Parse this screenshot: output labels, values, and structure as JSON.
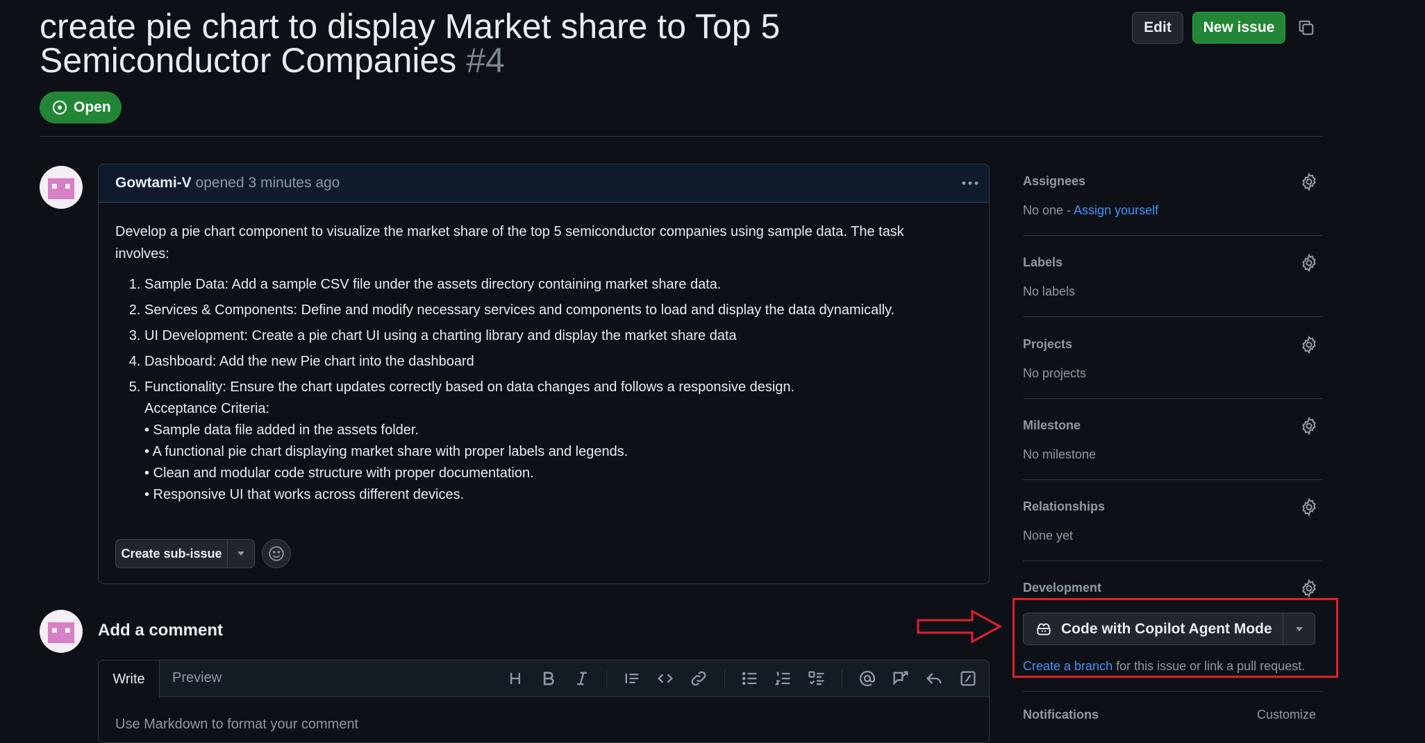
{
  "issue": {
    "title": "create pie chart to display Market share to Top 5 Semiconductor Companies",
    "number": "#4",
    "state": "Open"
  },
  "header": {
    "edit_label": "Edit",
    "new_issue_label": "New issue"
  },
  "comment": {
    "author": "Gowtami-V",
    "meta": "opened 3 minutes ago",
    "intro": "Develop a pie chart component to visualize the market share of the top 5 semiconductor companies using sample data. The task involves:",
    "tasks": [
      "Sample Data: Add a sample CSV file under the assets directory containing market share data.",
      "Services & Components: Define and modify necessary services and components to load and display the data dynamically.",
      "UI Development: Create a pie chart UI using a charting library and display the market share data",
      "Dashboard: Add the new Pie chart into the dashboard",
      "Functionality: Ensure the chart updates correctly based on data changes and follows a responsive design."
    ],
    "criteria_heading": "Acceptance Criteria:",
    "criteria": [
      "• Sample data file added in the assets folder.",
      "• A functional pie chart displaying market share with proper labels and legends.",
      "• Clean and modular code structure with proper documentation.",
      "• Responsive UI that works across different devices."
    ],
    "create_sub_issue_label": "Create sub-issue"
  },
  "new_comment": {
    "heading": "Add a comment",
    "tab_write": "Write",
    "tab_preview": "Preview",
    "placeholder": "Use Markdown to format your comment"
  },
  "sidebar": {
    "assignees": {
      "title": "Assignees",
      "value_prefix": "No one - ",
      "link": "Assign yourself"
    },
    "labels": {
      "title": "Labels",
      "value": "No labels"
    },
    "projects": {
      "title": "Projects",
      "value": "No projects"
    },
    "milestone": {
      "title": "Milestone",
      "value": "No milestone"
    },
    "relationships": {
      "title": "Relationships",
      "value": "None yet"
    },
    "development": {
      "title": "Development",
      "button_label": "Code with Copilot Agent Mode",
      "link": "Create a branch",
      "note_suffix": " for this issue or link a pull request."
    },
    "notifications": {
      "title": "Notifications",
      "customize": "Customize"
    }
  },
  "colors": {
    "background": "#0d1117",
    "success": "#238636",
    "link": "#4493f8",
    "annotation": "#e0202c"
  },
  "icons": [
    "copy-icon",
    "issue-open-icon",
    "kebab-icon",
    "gear-icon",
    "copilot-icon",
    "chevron-down-icon",
    "smiley-icon",
    "annotation-arrow"
  ]
}
